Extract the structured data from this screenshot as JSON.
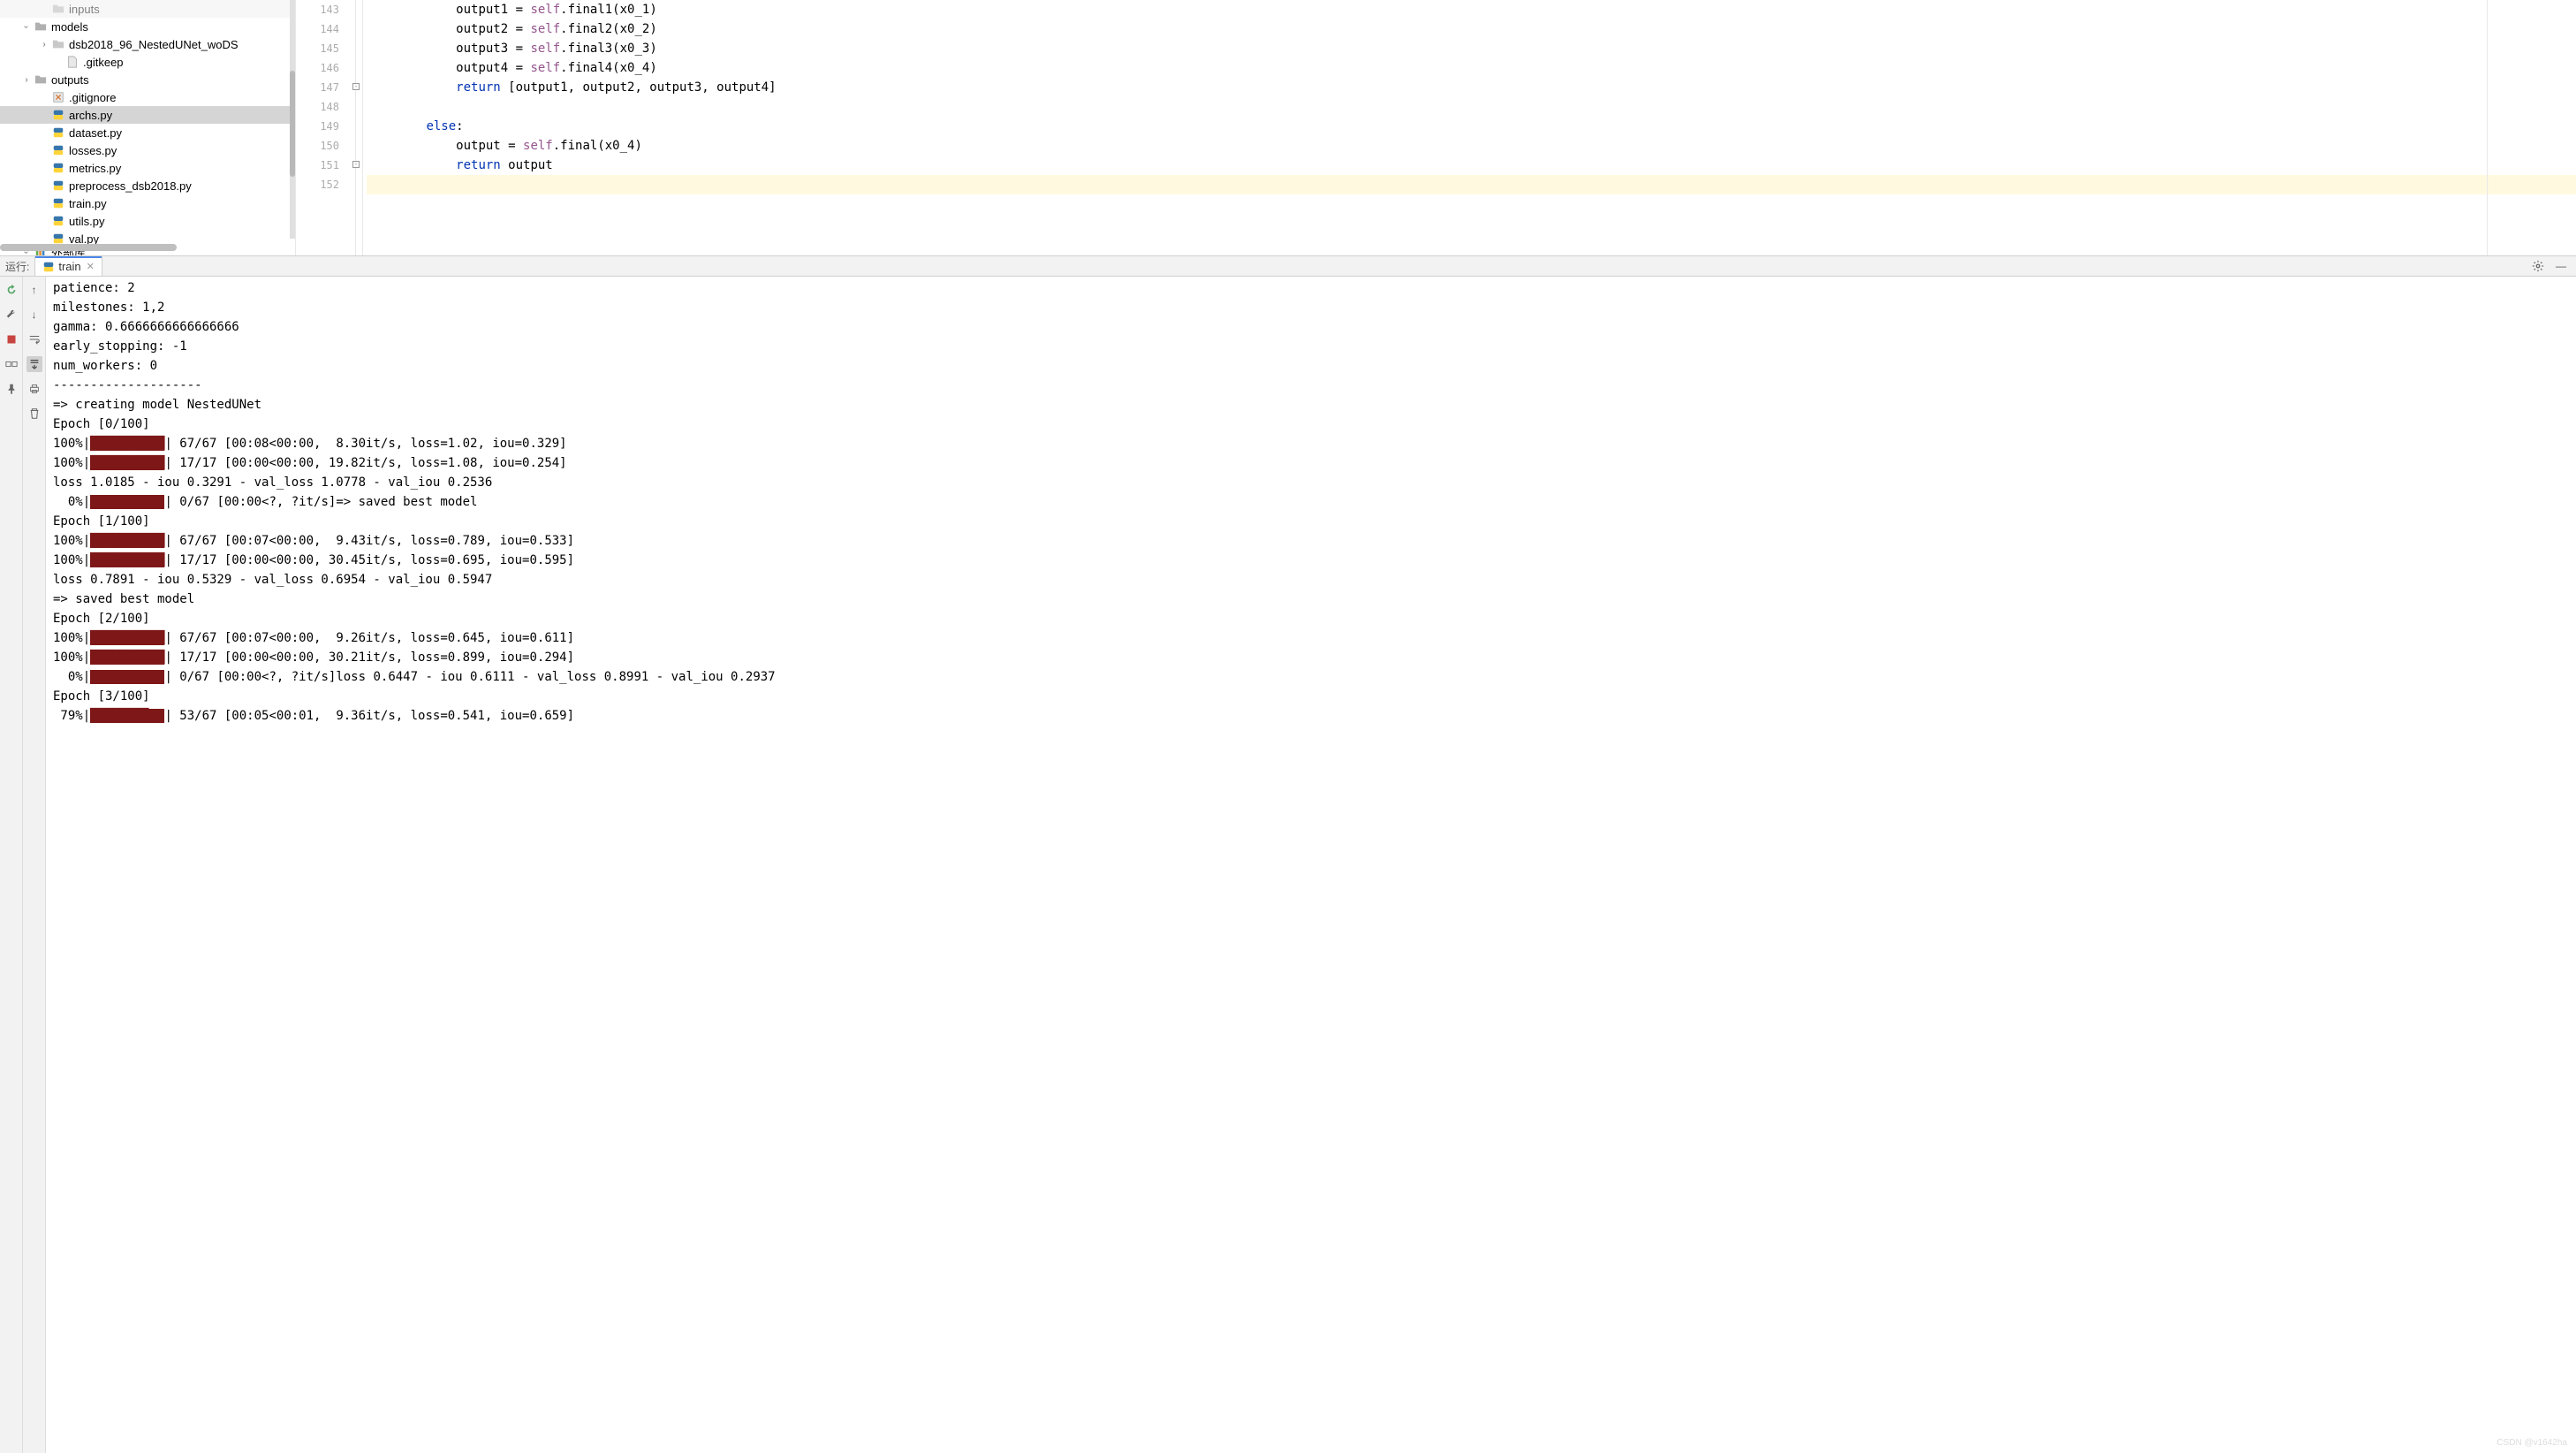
{
  "fileTree": {
    "items": [
      {
        "indent": 42,
        "chevron": "",
        "iconType": "folder",
        "label": "inputs",
        "selected": false,
        "dim": true
      },
      {
        "indent": 22,
        "chevron": "v",
        "iconType": "folder",
        "label": "models",
        "selected": false
      },
      {
        "indent": 42,
        "chevron": ">",
        "iconType": "folder-grey",
        "label": "dsb2018_96_NestedUNet_woDS",
        "selected": false
      },
      {
        "indent": 58,
        "chevron": "",
        "iconType": "file",
        "label": ".gitkeep",
        "selected": false
      },
      {
        "indent": 22,
        "chevron": ">",
        "iconType": "folder",
        "label": "outputs",
        "selected": false
      },
      {
        "indent": 42,
        "chevron": "",
        "iconType": "gitignore",
        "label": ".gitignore",
        "selected": false
      },
      {
        "indent": 42,
        "chevron": "",
        "iconType": "py",
        "label": "archs.py",
        "selected": true
      },
      {
        "indent": 42,
        "chevron": "",
        "iconType": "py",
        "label": "dataset.py",
        "selected": false
      },
      {
        "indent": 42,
        "chevron": "",
        "iconType": "py",
        "label": "losses.py",
        "selected": false
      },
      {
        "indent": 42,
        "chevron": "",
        "iconType": "py",
        "label": "metrics.py",
        "selected": false
      },
      {
        "indent": 42,
        "chevron": "",
        "iconType": "py",
        "label": "preprocess_dsb2018.py",
        "selected": false
      },
      {
        "indent": 42,
        "chevron": "",
        "iconType": "py",
        "label": "train.py",
        "selected": false
      },
      {
        "indent": 42,
        "chevron": "",
        "iconType": "py",
        "label": "utils.py",
        "selected": false
      },
      {
        "indent": 42,
        "chevron": "",
        "iconType": "py",
        "label": "val.py",
        "selected": false
      },
      {
        "indent": 22,
        "chevron": "v",
        "iconType": "lib",
        "label": "外部库",
        "selected": false,
        "cut": true
      }
    ]
  },
  "editor": {
    "lines": [
      {
        "num": "143",
        "indent": "            ",
        "segments": [
          [
            "ident",
            "output1 = "
          ],
          [
            "self",
            "self"
          ],
          [
            "ident",
            ".final1(x0_1)"
          ]
        ]
      },
      {
        "num": "144",
        "indent": "            ",
        "segments": [
          [
            "ident",
            "output2 = "
          ],
          [
            "self",
            "self"
          ],
          [
            "ident",
            ".final2(x0_2)"
          ]
        ]
      },
      {
        "num": "145",
        "indent": "            ",
        "segments": [
          [
            "ident",
            "output3 = "
          ],
          [
            "self",
            "self"
          ],
          [
            "ident",
            ".final3(x0_3)"
          ]
        ]
      },
      {
        "num": "146",
        "indent": "            ",
        "segments": [
          [
            "ident",
            "output4 = "
          ],
          [
            "self",
            "self"
          ],
          [
            "ident",
            ".final4(x0_4)"
          ]
        ]
      },
      {
        "num": "147",
        "indent": "            ",
        "segments": [
          [
            "kw",
            "return"
          ],
          [
            "ident",
            " [output1, output2, output3, output4]"
          ]
        ]
      },
      {
        "num": "148",
        "indent": "",
        "segments": []
      },
      {
        "num": "149",
        "indent": "        ",
        "segments": [
          [
            "kw",
            "else"
          ],
          [
            "ident",
            ":"
          ]
        ]
      },
      {
        "num": "150",
        "indent": "            ",
        "segments": [
          [
            "ident",
            "output = "
          ],
          [
            "self",
            "self"
          ],
          [
            "ident",
            ".final(x0_4)"
          ]
        ]
      },
      {
        "num": "151",
        "indent": "            ",
        "segments": [
          [
            "kw",
            "return"
          ],
          [
            "ident",
            " output"
          ]
        ]
      },
      {
        "num": "152",
        "indent": "",
        "segments": [],
        "current": true
      }
    ]
  },
  "runToolbar": {
    "label": "运行:",
    "tabName": "train"
  },
  "console": {
    "lines": [
      {
        "type": "plain",
        "text": "patience: 2"
      },
      {
        "type": "plain",
        "text": "milestones: 1,2"
      },
      {
        "type": "plain",
        "text": "gamma: 0.6666666666666666"
      },
      {
        "type": "plain",
        "text": "early_stopping: -1"
      },
      {
        "type": "plain",
        "text": "num_workers: 0"
      },
      {
        "type": "plain",
        "text": "--------------------"
      },
      {
        "type": "plain",
        "text": "=> creating model NestedUNet"
      },
      {
        "type": "plain",
        "text": "Epoch [0/100]"
      },
      {
        "type": "progress",
        "pct": "100%",
        "bar": "██████████",
        "after": "| 67/67 [00:08<00:00,  8.30it/s, loss=1.02, iou=0.329]"
      },
      {
        "type": "progress",
        "pct": "100%",
        "bar": "██████████",
        "after": "| 17/17 [00:00<00:00, 19.82it/s, loss=1.08, iou=0.254]"
      },
      {
        "type": "plain",
        "text": "loss 1.0185 - iou 0.3291 - val_loss 1.0778 - val_iou 0.2536"
      },
      {
        "type": "progress",
        "pct": "  0%",
        "bar": "          ",
        "after": "| 0/67 [00:00<?, ?it/s]=> saved best model"
      },
      {
        "type": "plain",
        "text": "Epoch [1/100]"
      },
      {
        "type": "progress",
        "pct": "100%",
        "bar": "██████████",
        "after": "| 67/67 [00:07<00:00,  9.43it/s, loss=0.789, iou=0.533]"
      },
      {
        "type": "progress",
        "pct": "100%",
        "bar": "██████████",
        "after": "| 17/17 [00:00<00:00, 30.45it/s, loss=0.695, iou=0.595]"
      },
      {
        "type": "plain",
        "text": "loss 0.7891 - iou 0.5329 - val_loss 0.6954 - val_iou 0.5947"
      },
      {
        "type": "plain",
        "text": "=> saved best model"
      },
      {
        "type": "plain",
        "text": "Epoch [2/100]"
      },
      {
        "type": "progress",
        "pct": "100%",
        "bar": "██████████",
        "after": "| 67/67 [00:07<00:00,  9.26it/s, loss=0.645, iou=0.611]"
      },
      {
        "type": "progress",
        "pct": "100%",
        "bar": "██████████",
        "after": "| 17/17 [00:00<00:00, 30.21it/s, loss=0.899, iou=0.294]"
      },
      {
        "type": "progress",
        "pct": "  0%",
        "bar": "          ",
        "after": "| 0/67 [00:00<?, ?it/s]loss 0.6447 - iou 0.6111 - val_loss 0.8991 - val_iou 0.2937"
      },
      {
        "type": "plain",
        "text": "Epoch [3/100]"
      },
      {
        "type": "progress",
        "pct": " 79%",
        "bar": "███████▉  ",
        "after": "| 53/67 [00:05<00:01,  9.36it/s, loss=0.541, iou=0.659]"
      }
    ]
  },
  "watermark": "CSDN @v1642ha"
}
